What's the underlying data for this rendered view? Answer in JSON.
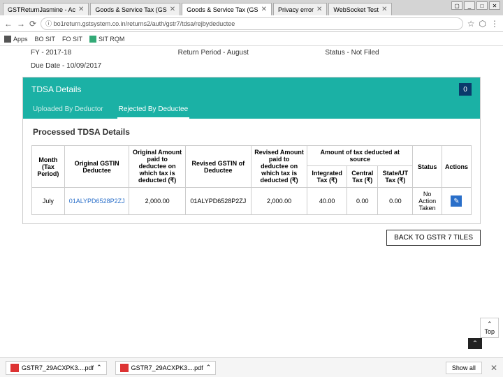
{
  "window_controls": [
    "▢",
    "_",
    "□",
    "✕"
  ],
  "browser_tabs": [
    {
      "title": "GSTReturnJasmine - Ac"
    },
    {
      "title": "Goods & Service Tax (GS"
    },
    {
      "title": "Goods & Service Tax (GS",
      "active": true
    },
    {
      "title": "Privacy error"
    },
    {
      "title": "WebSocket Test"
    }
  ],
  "url": "bo1return.gstsystem.co.in/returns2/auth/gstr7/tdsa/rejbydeductee",
  "bookmarks": [
    "Apps",
    "BO SIT",
    "FO SIT",
    "SIT RQM"
  ],
  "info": {
    "fy_label": "FY - ",
    "fy_val": "2017-18",
    "due_label": "Due Date - ",
    "due_val": "10/09/2017",
    "period_label": "Return Period - ",
    "period_val": "August",
    "status_label": "Status - ",
    "status_val": "Not Filed"
  },
  "panel": {
    "title": "TDSA Details",
    "badge": "0",
    "tabs": [
      "Uploaded By Deductor",
      "Rejected By Deductee"
    ],
    "active_tab": 1,
    "section": "Processed TDSA Details"
  },
  "headers": {
    "month": "Month (Tax Period)",
    "orig_gstin": "Original GSTIN Deductee",
    "orig_amt": "Original Amount paid to deductee on which tax is deducted (₹)",
    "rev_gstin": "Revised GSTIN of Deductee",
    "rev_amt": "Revised Amount paid to deductee on which tax is deducted (₹)",
    "tax_group": "Amount of tax deducted at source",
    "itax": "Integrated Tax (₹)",
    "ctax": "Central Tax (₹)",
    "stax": "State/UT Tax (₹)",
    "status": "Status",
    "actions": "Actions"
  },
  "row": {
    "month": "July",
    "orig_gstin": "01ALYPD6528P2ZJ",
    "orig_amt": "2,000.00",
    "rev_gstin": "01ALYPD6528P2ZJ",
    "rev_amt": "2,000.00",
    "itax": "40.00",
    "ctax": "0.00",
    "stax": "0.00",
    "status": "No Action Taken",
    "action_icon": "✎"
  },
  "back_btn": "BACK TO GSTR 7 TILES",
  "top_btn": "Top",
  "downloads": [
    {
      "name": "GSTR7_29ACXPK3....pdf"
    },
    {
      "name": "GSTR7_29ACXPK3....pdf"
    }
  ],
  "showall": "Show all"
}
